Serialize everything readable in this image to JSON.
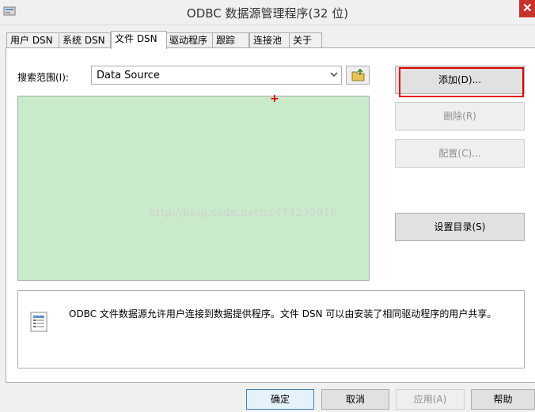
{
  "window": {
    "title": "ODBC 数据源管理程序(32 位)",
    "close_glyph": "✕",
    "app_icon": "odbc-app-icon"
  },
  "tabs": [
    {
      "label": "用户 DSN",
      "active": false
    },
    {
      "label": "系统 DSN",
      "active": false
    },
    {
      "label": "文件 DSN",
      "active": true
    },
    {
      "label": "驱动程序",
      "active": false
    },
    {
      "label": "跟踪",
      "active": false
    },
    {
      "label": "连接池",
      "active": false
    },
    {
      "label": "关于",
      "active": false
    }
  ],
  "search": {
    "label": "搜索范围(I):",
    "selected_value": "Data Source"
  },
  "buttons": {
    "add": "添加(D)...",
    "delete": "删除(R)",
    "config": "配置(C)...",
    "set_dir": "设置目录(S)"
  },
  "watermark": "http://blog.csdn.net/zc474235918",
  "info": {
    "text": "ODBC 文件数据源允许用户连接到数据提供程序。文件 DSN 可以由安装了相同驱动程序的用户共享。"
  },
  "footer": {
    "ok": "确定",
    "cancel": "取消",
    "apply": "应用(A)",
    "help": "帮助"
  },
  "colors": {
    "list_bg": "#c9ebcc",
    "highlight": "#e00000",
    "close_bg": "#c7322b"
  }
}
